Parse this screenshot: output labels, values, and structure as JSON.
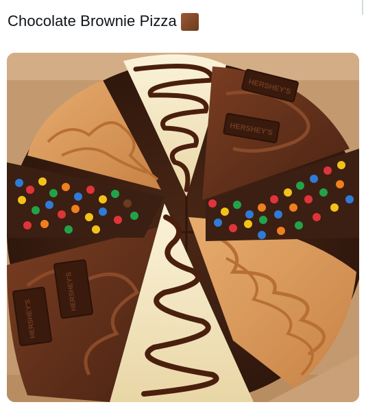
{
  "post": {
    "text": "Chocolate Brownie Pizza",
    "emoji_name": "brown-square-emoji"
  },
  "image": {
    "logo_text": "HERSHEY'S"
  },
  "colors": {
    "box_cardboard": "#c9a077",
    "brownie": "#3b1f12",
    "chocolate": "#5a2a17",
    "vanilla": "#f3e6c4",
    "peanut_butter": "#d79b5c"
  }
}
